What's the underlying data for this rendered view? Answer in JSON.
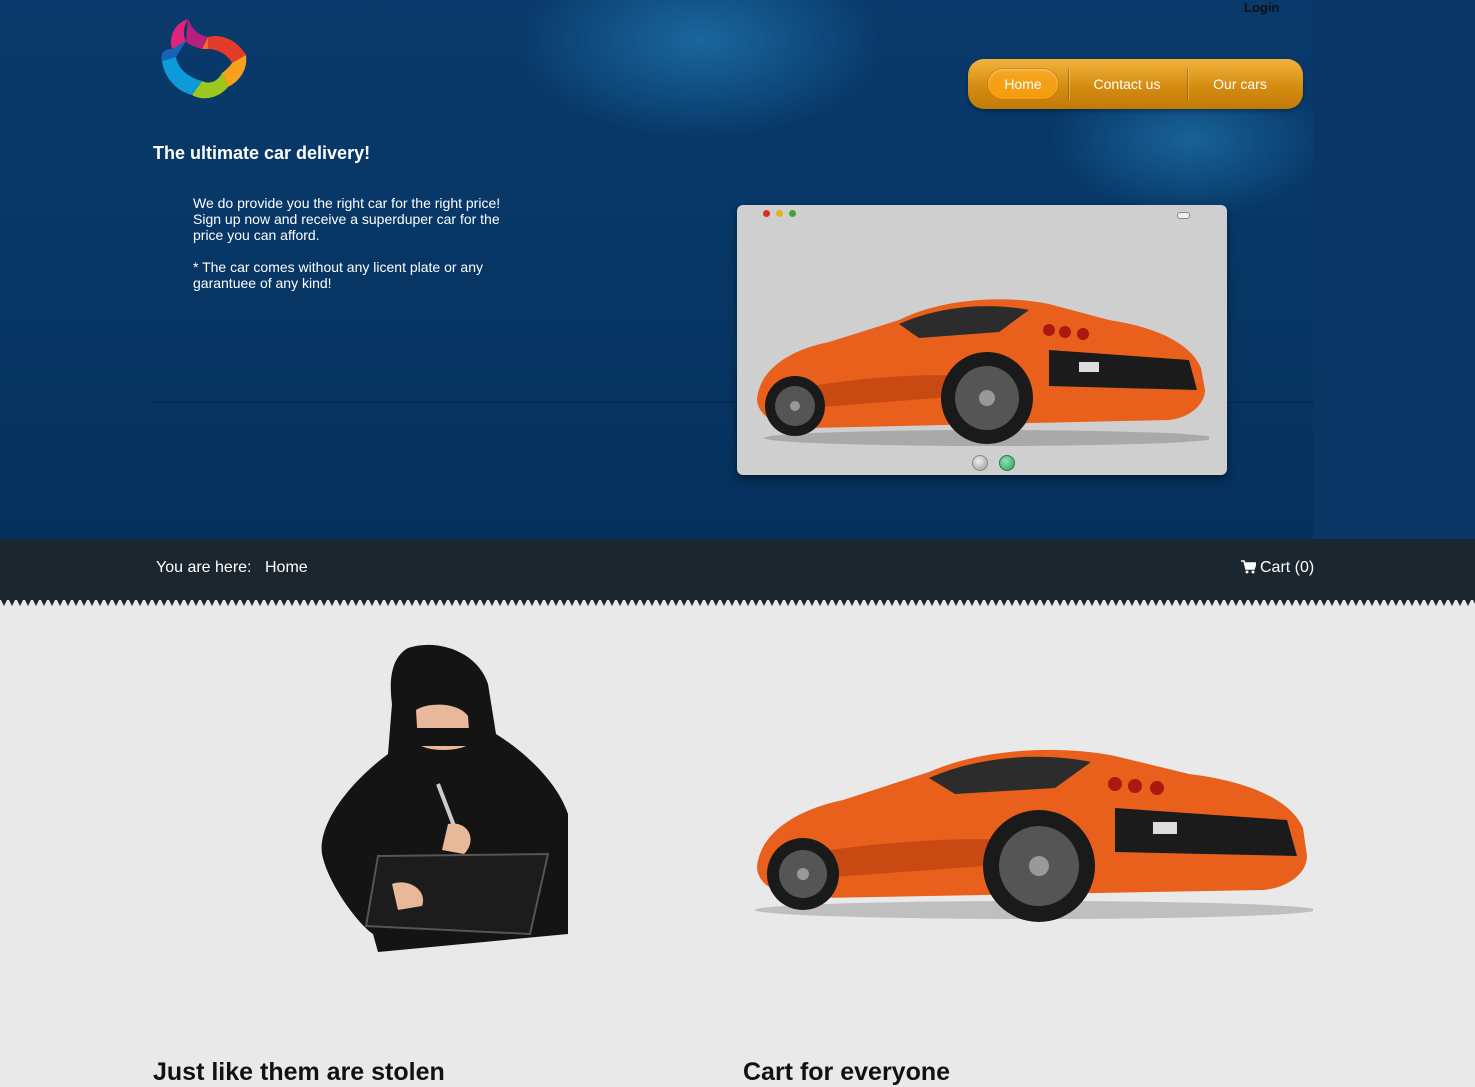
{
  "header": {
    "login": "Login",
    "nav": [
      {
        "label": "Home",
        "active": true
      },
      {
        "label": "Contact us",
        "active": false
      },
      {
        "label": "Our cars",
        "active": false
      }
    ],
    "tagline": "The ultimate car delivery!",
    "intro": [
      "We do provide you the right car for the right price! Sign up now and receive a superduper car for the price you can afford.",
      "* The car comes without any licent plate or any garantuee of any kind!"
    ]
  },
  "slider": {
    "slides": 2,
    "active_slide": 2
  },
  "breadcrumb": {
    "label": "You are here:",
    "current": "Home"
  },
  "cart": {
    "label": "Cart (0)",
    "icon": "shopping-cart-icon"
  },
  "sections": [
    {
      "heading": "Just like them are stolen"
    },
    {
      "heading": "Cart for everyone"
    }
  ],
  "colors": {
    "hero_bg": "#073766",
    "nav_orange": "#f49b0b",
    "bar_bg": "#1c262e",
    "content_bg": "#e9e9e9",
    "car_orange": "#e8601c"
  }
}
